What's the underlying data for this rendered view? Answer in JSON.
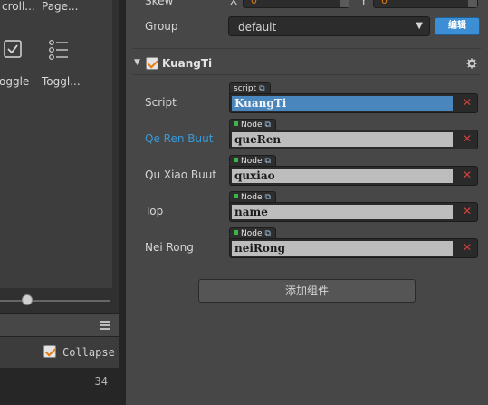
{
  "toolbox": {
    "items": [
      {
        "label": "croll...",
        "icon": "scrollview-icon"
      },
      {
        "label": "Page...",
        "icon": "pageview-icon"
      },
      {
        "label": "oggle",
        "icon": "toggle-icon"
      },
      {
        "label": "Toggl...",
        "icon": "togglegroup-icon"
      }
    ]
  },
  "console": {
    "collapse_label": "Collapse",
    "collapse_checked": true,
    "count": "34"
  },
  "inspector": {
    "skew": {
      "label": "Skew",
      "x_label": "X",
      "x_value": "0",
      "y_label": "Y",
      "y_value": "0"
    },
    "group": {
      "label": "Group",
      "value": "default",
      "edit_button": "编辑"
    },
    "component": {
      "name": "KuangTi",
      "enabled": true,
      "fields": [
        {
          "label": "Script",
          "tag": "script",
          "value": "KuangTi",
          "kind": "script",
          "highlighted": false
        },
        {
          "label": "Qe Ren Buut",
          "tag": "Node",
          "value": "queRen",
          "kind": "node",
          "highlighted": true
        },
        {
          "label": "Qu Xiao Buut",
          "tag": "Node",
          "value": "quxiao",
          "kind": "node",
          "highlighted": false
        },
        {
          "label": "Top",
          "tag": "Node",
          "value": "name",
          "kind": "node",
          "highlighted": false
        },
        {
          "label": "Nei Rong",
          "tag": "Node",
          "value": "neiRong",
          "kind": "node",
          "highlighted": false
        }
      ]
    },
    "add_component_label": "添加组件"
  },
  "colors": {
    "accent_blue": "#3c8fd4",
    "script_field": "#4a86be",
    "highlight_label": "#3a9ad9",
    "check_orange": "#e37b12",
    "clear_red": "#d0413a",
    "node_tag_green": "#3bb54a"
  }
}
